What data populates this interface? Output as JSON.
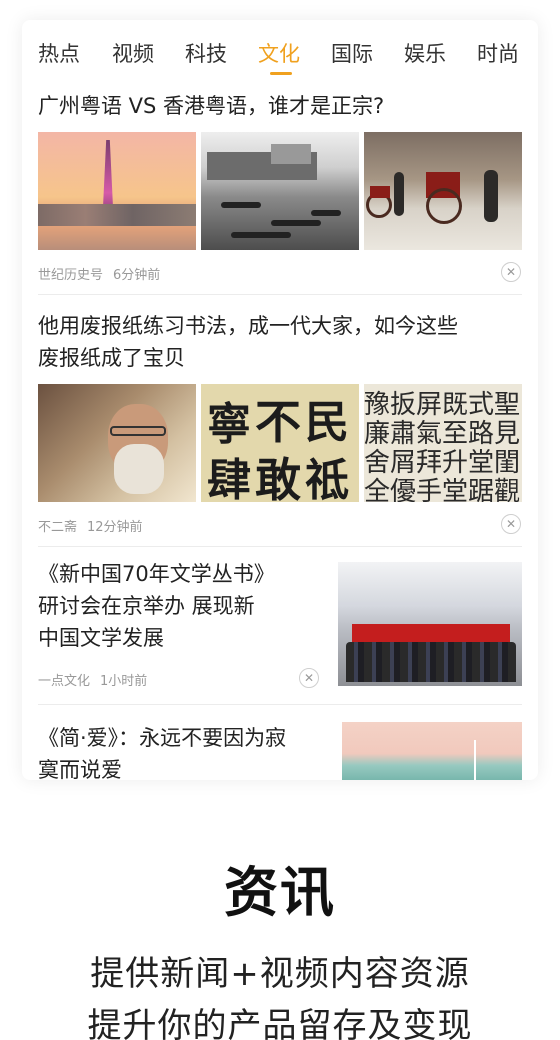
{
  "tabs": [
    {
      "label": "热点"
    },
    {
      "label": "视频"
    },
    {
      "label": "科技"
    },
    {
      "label": "文化",
      "active": true
    },
    {
      "label": "国际"
    },
    {
      "label": "娱乐"
    },
    {
      "label": "时尚"
    }
  ],
  "accent_color": "#f0a11f",
  "feed": [
    {
      "title": "广州粤语 VS 香港粤语，谁才是正宗?",
      "source": "世纪历史号",
      "time": "6分钟前",
      "images": [
        "canton-tower-photo",
        "old-harbor-photo",
        "rickshaw-photo"
      ]
    },
    {
      "title_line1": "他用废报纸练习书法，成一代大家，如今这些",
      "title_line2": "废报纸成了宝贝",
      "source": "不二斋",
      "time": "12分钟前",
      "images": [
        "calligrapher-portrait",
        "calligraphy-scroll-1",
        "calligraphy-scroll-2"
      ],
      "calligraphy_1": [
        "寧",
        "不",
        "民",
        "肆",
        "敢",
        "祗"
      ],
      "calligraphy_2": [
        "豫",
        "扳",
        "屏",
        "既",
        "式",
        "聖",
        "廉",
        "肅",
        "氣",
        "至",
        "路",
        "見",
        "舍",
        "屑",
        "拜",
        "升",
        "堂",
        "閨",
        "全",
        "優",
        "手",
        "堂",
        "踞",
        "觀"
      ]
    },
    {
      "title_line1": "《新中国70年文学丛书》",
      "title_line2": "研讨会在京举办   展现新",
      "title_line3": "中国文学发展",
      "source": "一点文化",
      "time": "1小时前",
      "image": "conference-photo"
    },
    {
      "title_line1": "《简·爱》：永远不要因为寂",
      "title_line2": "寞而说爱",
      "image": "seascape-photo"
    }
  ],
  "close_icon": "close-icon",
  "promo": {
    "heading": "资讯",
    "line1": "提供新闻+视频内容资源",
    "line2": "提升你的产品留存及变现"
  }
}
